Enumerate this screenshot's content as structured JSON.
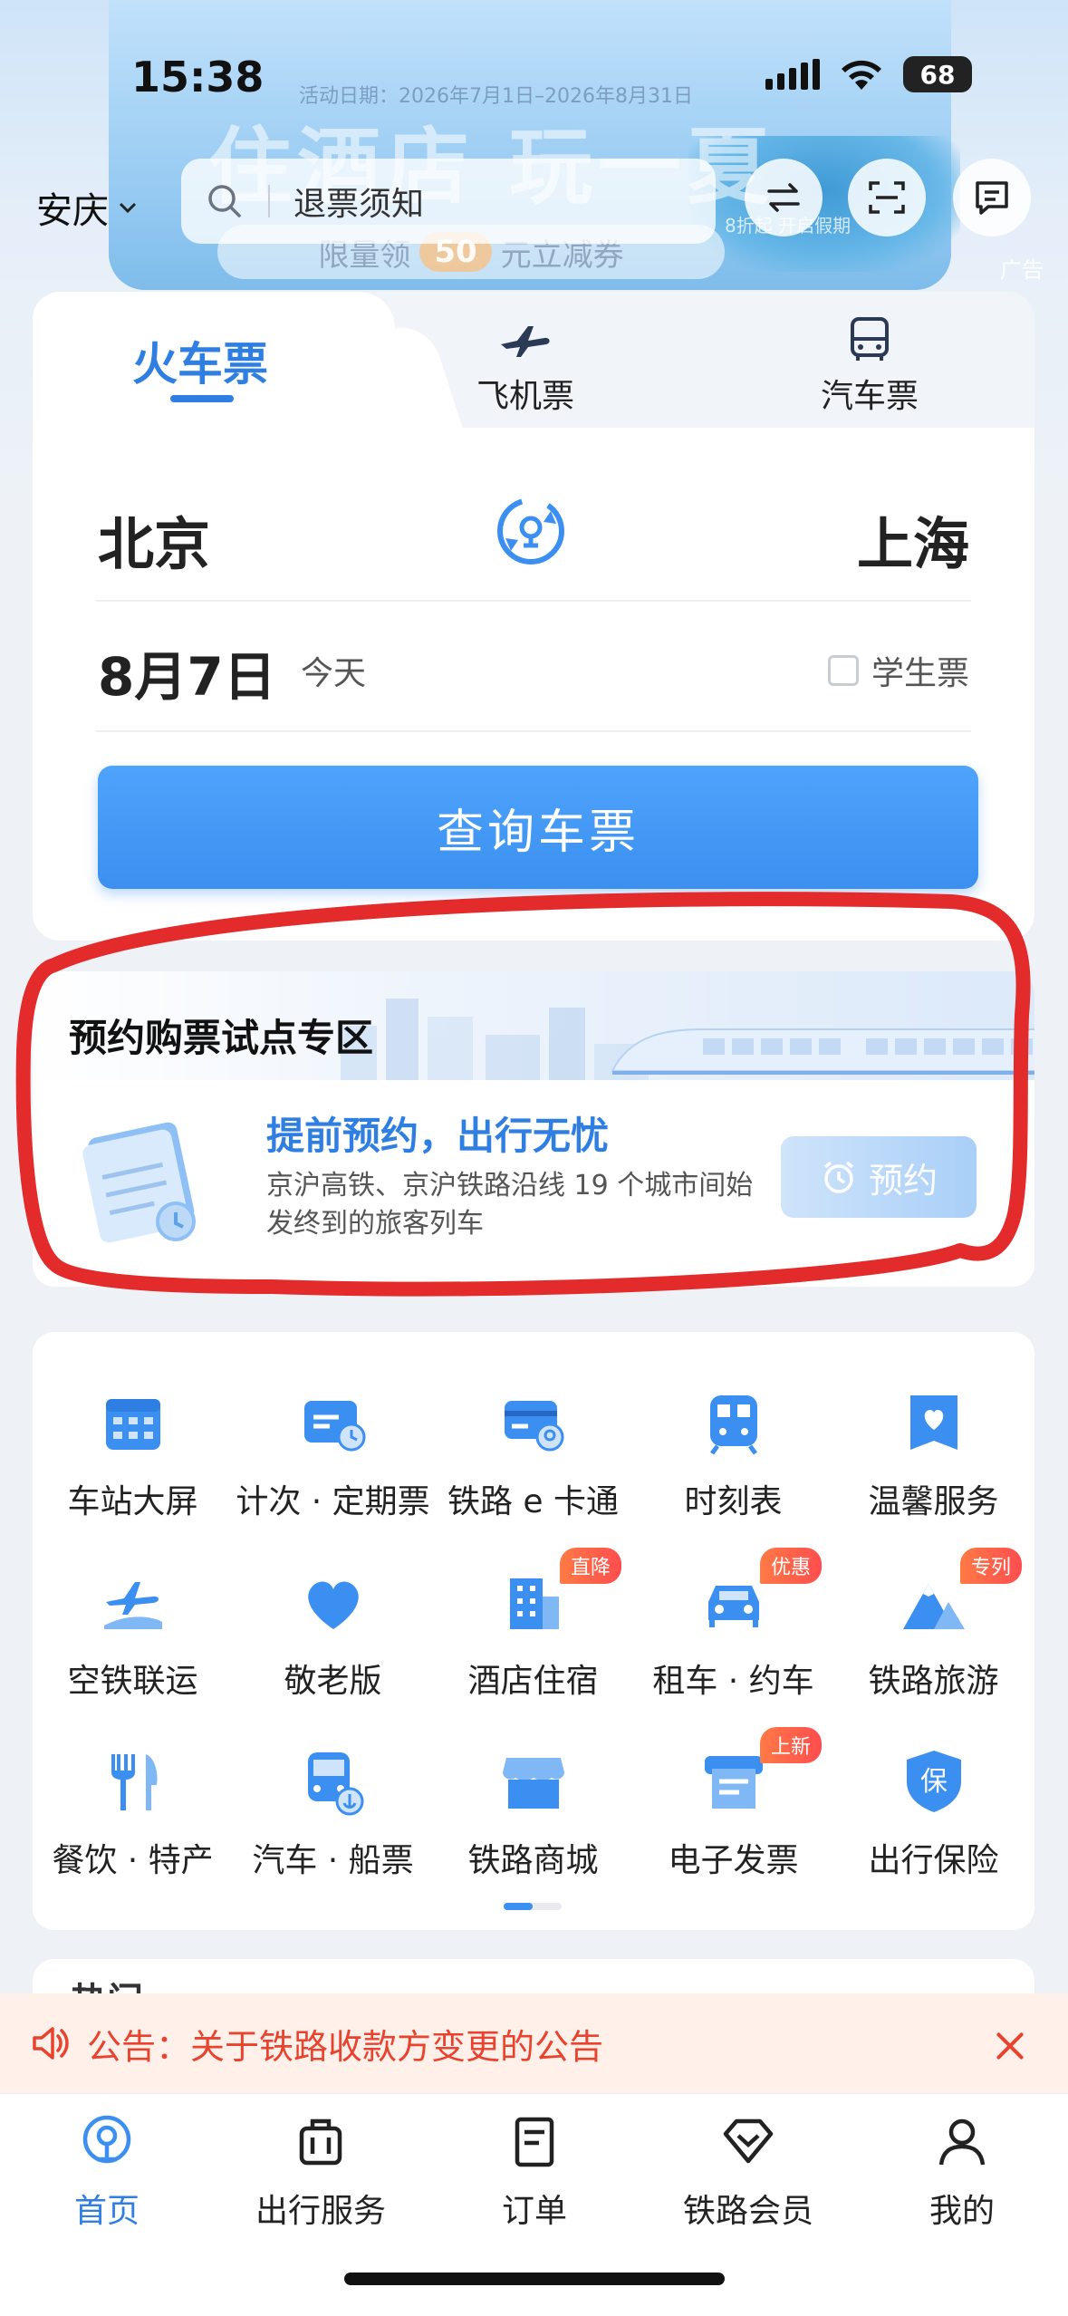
{
  "status_bar": {
    "time": "15:38",
    "battery": "68"
  },
  "banner": {
    "date_range": "活动日期：2026年7月1日–2026年8月31日",
    "headline": "住酒店 玩一夏",
    "pill_prefix": "限量领",
    "pill_amount": "50",
    "pill_suffix": "元立减券",
    "badge": "8折起 开启假期",
    "ad_label": "广告"
  },
  "header": {
    "city": "安庆",
    "search_placeholder": "退票须知"
  },
  "ticket": {
    "tabs": [
      {
        "label": "火车票",
        "icon": "train-icon"
      },
      {
        "label": "飞机票",
        "icon": "airplane-icon"
      },
      {
        "label": "汽车票",
        "icon": "bus-icon"
      }
    ],
    "from": "北京",
    "to": "上海",
    "date": "8月7日",
    "date_sub": "今天",
    "student_label": "学生票",
    "search_button": "查询车票"
  },
  "reservation": {
    "title": "预约购票试点专区",
    "headline": "提前预约，出行无忧",
    "description": "京沪高铁、京沪铁路沿线 19 个城市间始发终到的旅客列车",
    "button": "预约",
    "accent_color": "#2f7fe3"
  },
  "services": [
    {
      "label": "车站大屏",
      "icon": "station-screen-icon",
      "tag": ""
    },
    {
      "label": "计次 · 定期票",
      "icon": "period-ticket-icon",
      "tag": ""
    },
    {
      "label": "铁路 e 卡通",
      "icon": "ecard-icon",
      "tag": ""
    },
    {
      "label": "时刻表",
      "icon": "timetable-icon",
      "tag": ""
    },
    {
      "label": "温馨服务",
      "icon": "warm-service-icon",
      "tag": ""
    },
    {
      "label": "空铁联运",
      "icon": "air-rail-icon",
      "tag": ""
    },
    {
      "label": "敬老版",
      "icon": "heart-icon",
      "tag": ""
    },
    {
      "label": "酒店住宿",
      "icon": "hotel-icon",
      "tag": "直降"
    },
    {
      "label": "租车 · 约车",
      "icon": "car-icon",
      "tag": "优惠"
    },
    {
      "label": "铁路旅游",
      "icon": "mountain-icon",
      "tag": "专列"
    },
    {
      "label": "餐饮 · 特产",
      "icon": "dining-icon",
      "tag": ""
    },
    {
      "label": "汽车 · 船票",
      "icon": "bus-ship-icon",
      "tag": ""
    },
    {
      "label": "铁路商城",
      "icon": "shop-icon",
      "tag": ""
    },
    {
      "label": "电子发票",
      "icon": "invoice-icon",
      "tag": "上新"
    },
    {
      "label": "出行保险",
      "icon": "insurance-icon",
      "tag": ""
    }
  ],
  "peek_text": "热门",
  "notice": {
    "text": "公告：关于铁路收款方变更的公告"
  },
  "bottom_nav": [
    {
      "label": "首页",
      "icon": "home-icon",
      "active": true
    },
    {
      "label": "出行服务",
      "icon": "luggage-icon",
      "active": false
    },
    {
      "label": "订单",
      "icon": "order-icon",
      "active": false
    },
    {
      "label": "铁路会员",
      "icon": "member-icon",
      "active": false
    },
    {
      "label": "我的",
      "icon": "profile-icon",
      "active": false
    }
  ]
}
